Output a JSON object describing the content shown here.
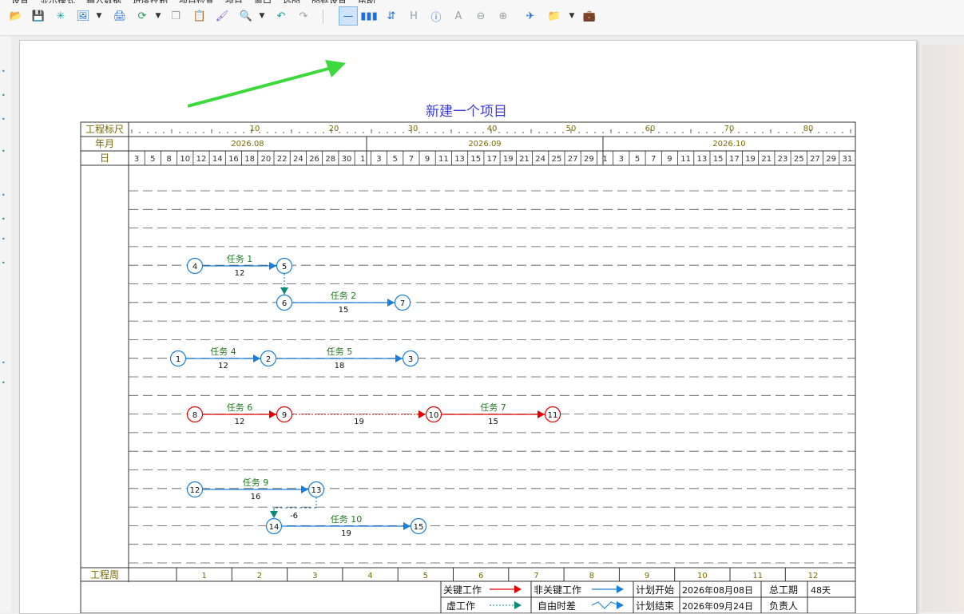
{
  "menu": {
    "items": [
      "设置",
      "显示模式",
      "输入数据",
      "进度控制",
      "项目检查",
      "项目",
      "窗口",
      "选图",
      "图框设置",
      "帮助"
    ]
  },
  "toolbar": {
    "buttons": [
      {
        "name": "open-folder-icon",
        "glyph": "📂"
      },
      {
        "name": "save-icon",
        "glyph": "💾"
      },
      {
        "name": "asterisk-icon",
        "glyph": "✳"
      },
      {
        "name": "image-icon",
        "glyph": "🖼"
      },
      {
        "name": "print-icon",
        "glyph": "🖨"
      },
      {
        "name": "refresh-icon",
        "glyph": "⟳"
      },
      {
        "name": "copy-icon",
        "glyph": "❐"
      },
      {
        "name": "paste-icon",
        "glyph": "📋"
      },
      {
        "name": "format-brush-icon",
        "glyph": "🖌"
      },
      {
        "name": "search-icon",
        "glyph": "🔍"
      },
      {
        "name": "undo-icon",
        "glyph": "↶"
      },
      {
        "name": "redo-icon",
        "glyph": "↷"
      },
      {
        "name": "horizontal-line-icon",
        "glyph": "—"
      },
      {
        "name": "bar-chart-icon",
        "glyph": "▮▮▮"
      },
      {
        "name": "sort-icon",
        "glyph": "⇵"
      },
      {
        "name": "h-icon",
        "glyph": "H"
      },
      {
        "name": "info-icon",
        "glyph": "ⓘ"
      },
      {
        "name": "text-icon",
        "glyph": "A"
      },
      {
        "name": "zoom-out-icon",
        "glyph": "⊖"
      },
      {
        "name": "zoom-in-icon",
        "glyph": "⊕"
      },
      {
        "name": "airplane-icon",
        "glyph": "✈"
      },
      {
        "name": "folder-icon",
        "glyph": "📁"
      },
      {
        "name": "briefcase-icon",
        "glyph": "💼"
      }
    ],
    "active": "horizontal-line-icon",
    "colors": {
      "blue": "#1e6fd9",
      "green": "#1f9d55",
      "teal": "#0ea5a5",
      "orange": "#e64a19",
      "purple": "#7c5cd6",
      "gray": "#9aa0a6"
    }
  },
  "chart_data": {
    "type": "network-schedule",
    "title": "新建一个项目",
    "row_labels": {
      "scale": "工程标尺",
      "month": "年月",
      "day": "日",
      "week": "工程周"
    },
    "scale_ticks": [
      "10",
      "20",
      "30",
      "40",
      "50",
      "60",
      "70",
      "80"
    ],
    "months": [
      "2026.08",
      "2026.09",
      "2026.10"
    ],
    "days": [
      "3",
      "5",
      "8",
      "10",
      "12",
      "14",
      "16",
      "18",
      "20",
      "22",
      "24",
      "26",
      "28",
      "30",
      "1",
      "3",
      "5",
      "7",
      "9",
      "11",
      "13",
      "15",
      "17",
      "19",
      "21",
      "24",
      "25",
      "27",
      "29",
      "1",
      "3",
      "5",
      "7",
      "9",
      "11",
      "13",
      "15",
      "17",
      "19",
      "21",
      "23",
      "25",
      "27",
      "29",
      "31"
    ],
    "weeks": [
      "1",
      "2",
      "3",
      "4",
      "5",
      "6",
      "7",
      "8",
      "9",
      "10",
      "11",
      "12"
    ],
    "nodes": [
      {
        "id": "4",
        "day": 1,
        "row": "r1",
        "critical": false
      },
      {
        "id": "5",
        "day": 12,
        "row": "r1",
        "critical": false
      },
      {
        "id": "6",
        "day": 12,
        "row": "r2",
        "critical": false
      },
      {
        "id": "7",
        "day": 27,
        "row": "r2",
        "critical": false
      },
      {
        "id": "1",
        "day": 0,
        "row": "r3",
        "critical": false
      },
      {
        "id": "2",
        "day": 12,
        "row": "r3",
        "critical": false
      },
      {
        "id": "3",
        "day": 30,
        "row": "r3",
        "critical": false
      },
      {
        "id": "8",
        "day": 1,
        "row": "r4",
        "critical": true
      },
      {
        "id": "9",
        "day": 12,
        "row": "r4",
        "critical": true
      },
      {
        "id": "10",
        "day": 31,
        "row": "r4",
        "critical": true
      },
      {
        "id": "11",
        "day": 46,
        "row": "r4",
        "critical": true
      },
      {
        "id": "12",
        "day": 1,
        "row": "r5",
        "critical": false
      },
      {
        "id": "13",
        "day": 17,
        "row": "r5",
        "critical": false
      },
      {
        "id": "14",
        "day": 11,
        "row": "r6",
        "critical": false
      },
      {
        "id": "15",
        "day": 30,
        "row": "r6",
        "critical": false
      }
    ],
    "tasks": [
      {
        "from": "4",
        "to": "5",
        "name": "任务 1",
        "duration": "12",
        "kind": "normal"
      },
      {
        "from": "6",
        "to": "7",
        "name": "任务 2",
        "duration": "15",
        "kind": "normal"
      },
      {
        "from": "1",
        "to": "2",
        "name": "任务 4",
        "duration": "12",
        "kind": "normal"
      },
      {
        "from": "2",
        "to": "3",
        "name": "任务 5",
        "duration": "18",
        "kind": "normal"
      },
      {
        "from": "8",
        "to": "9",
        "name": "任务 6",
        "duration": "12",
        "kind": "critical"
      },
      {
        "from": "9",
        "to": "10",
        "name": "",
        "duration": "19",
        "kind": "critical-float"
      },
      {
        "from": "10",
        "to": "11",
        "name": "任务 7",
        "duration": "15",
        "kind": "critical"
      },
      {
        "from": "12",
        "to": "13",
        "name": "任务 9",
        "duration": "16",
        "kind": "normal"
      },
      {
        "from": "14",
        "to": "15",
        "name": "任务 10",
        "duration": "19",
        "kind": "normal"
      }
    ],
    "dummies": [
      {
        "from": "5",
        "to": "6"
      },
      {
        "from": "13",
        "to": "14",
        "label": "-6"
      }
    ],
    "legend": [
      {
        "label": "关键工作",
        "kind": "critical"
      },
      {
        "label": "非关键工作",
        "kind": "normal"
      },
      {
        "label": "虚工作",
        "kind": "dummy"
      },
      {
        "label": "自由时差",
        "kind": "float"
      }
    ],
    "info": {
      "plan_start_label": "计划开始",
      "plan_start": "2026年08月08日",
      "plan_end_label": "计划结束",
      "plan_end": "2026年09月24日",
      "total_label": "总工期",
      "total": "48天",
      "owner_label": "负责人",
      "owner": ""
    },
    "colors": {
      "critical": "#e00000",
      "normal": "#1a7fd8",
      "dummy": "#0d8a7a",
      "label": "#1f7a1f",
      "grid": "#333333",
      "header_text": "#7a6a00",
      "title": "#3b3bd6"
    }
  }
}
